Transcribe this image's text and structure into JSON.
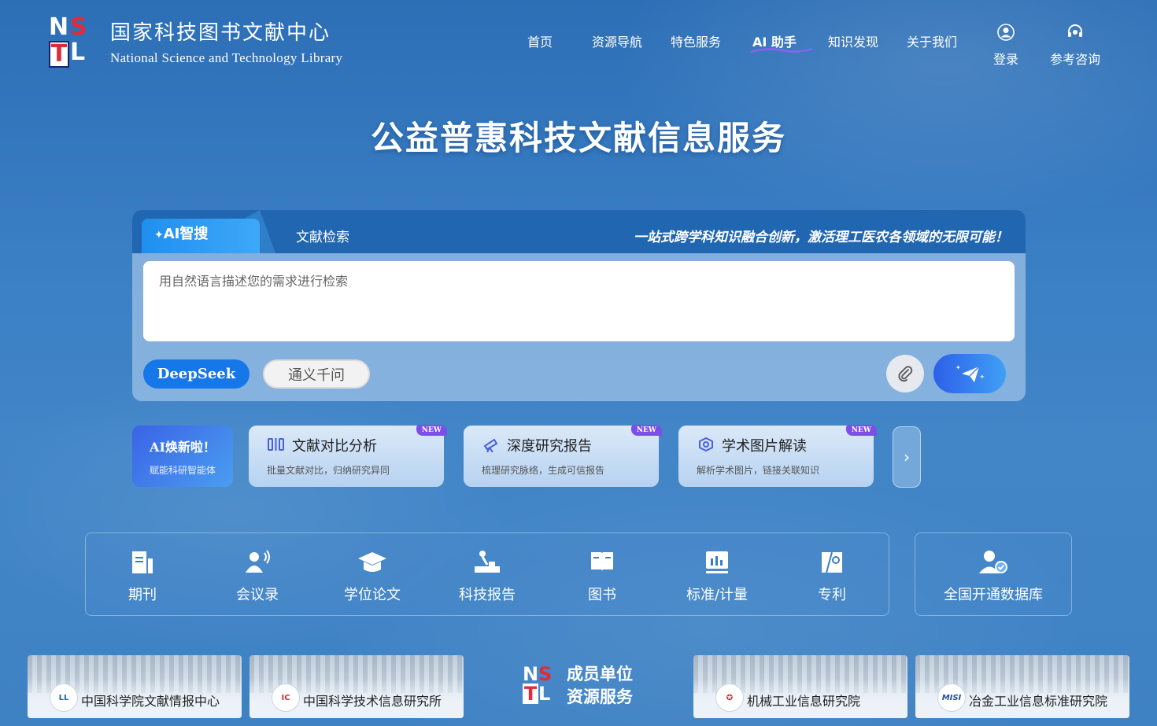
{
  "logo": {
    "mark_letters": [
      "N",
      "S",
      "T",
      "L"
    ],
    "name_cn": "国家科技图书文献中心",
    "name_en": "National Science and Technology Library"
  },
  "nav": {
    "items": [
      "首页",
      "资源导航",
      "特色服务",
      "AI 助手",
      "知识发现",
      "关于我们"
    ]
  },
  "actions": {
    "login": "登录",
    "consult": "参考咨询"
  },
  "hero": {
    "title": "公益普惠科技文献信息服务"
  },
  "search": {
    "tab_ai": "AI智搜",
    "tab_literature": "文献检索",
    "slogan": "一站式跨学科知识融合创新，激活理工医农各领域的无限可能！",
    "placeholder": "用自然语言描述您的需求进行检索",
    "models": [
      "DeepSeek",
      "通义千问"
    ],
    "selected_model": "DeepSeek"
  },
  "features": {
    "promo_title": "AI焕新啦！",
    "promo_sub": "赋能科研智能体",
    "cards": [
      {
        "title": "文献对比分析",
        "desc": "批量文献对比，归纳研究异同",
        "badge": "NEW",
        "icon": "compare-icon"
      },
      {
        "title": "深度研究报告",
        "desc": "梳理研究脉络，生成可信报告",
        "badge": "NEW",
        "icon": "telescope-icon"
      },
      {
        "title": "学术图片解读",
        "desc": "解析学术图片，链接关联知识",
        "badge": "NEW",
        "icon": "image-analysis-icon"
      }
    ]
  },
  "resources": {
    "items": [
      {
        "label": "期刊",
        "icon": "journal-icon"
      },
      {
        "label": "会议录",
        "icon": "conference-icon"
      },
      {
        "label": "学位论文",
        "icon": "graduation-cap-icon"
      },
      {
        "label": "科技报告",
        "icon": "report-icon"
      },
      {
        "label": "图书",
        "icon": "book-icon"
      },
      {
        "label": "标准/计量",
        "icon": "standard-icon"
      },
      {
        "label": "专利",
        "icon": "patent-icon"
      }
    ],
    "database_label": "全国开通数据库"
  },
  "members": {
    "center_line1": "成员单位",
    "center_line2": "资源服务",
    "units": [
      {
        "name": "中国科学院文献情报中心",
        "icon": "cas-library-logo"
      },
      {
        "name": "中国科学技术信息研究所",
        "icon": "istic-logo"
      },
      {
        "name": "机械工业信息研究院",
        "icon": "cmiri-logo"
      },
      {
        "name": "冶金工业信息标准研究院",
        "icon": "misi-logo"
      }
    ]
  },
  "colors": {
    "background": "#3a7ec4",
    "accent_blue": "#1677e8",
    "badge_purple": "#7c4fe8",
    "logo_red": "#e02b3a",
    "logo_navy": "#13276b"
  }
}
